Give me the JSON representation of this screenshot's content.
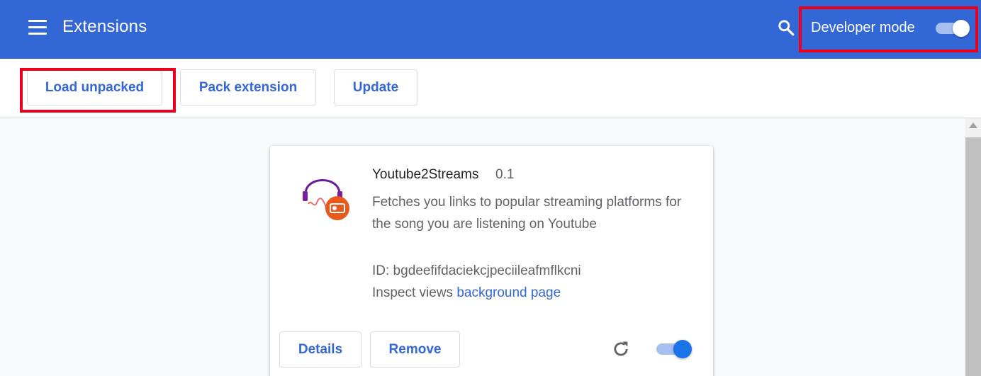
{
  "header": {
    "title": "Extensions",
    "menu_icon": "hamburger-menu-icon",
    "search_icon": "search-icon",
    "developer_mode_label": "Developer mode",
    "developer_mode_on": true,
    "color": "#3367d6"
  },
  "toolbar": {
    "load_unpacked": "Load unpacked",
    "pack_extension": "Pack extension",
    "update": "Update"
  },
  "extension": {
    "name": "Youtube2Streams",
    "version": "0.1",
    "description": "Fetches you links to popular streaming platforms for the song you are listening on Youtube",
    "id": "ID: bgdeefifdaciekcjpeciileafmflkcni",
    "inspect_label": "Inspect views",
    "inspect_link": "background page",
    "details": "Details",
    "remove": "Remove",
    "reload_icon": "reload-icon",
    "enabled": true
  },
  "highlight_color": "#e8001c"
}
